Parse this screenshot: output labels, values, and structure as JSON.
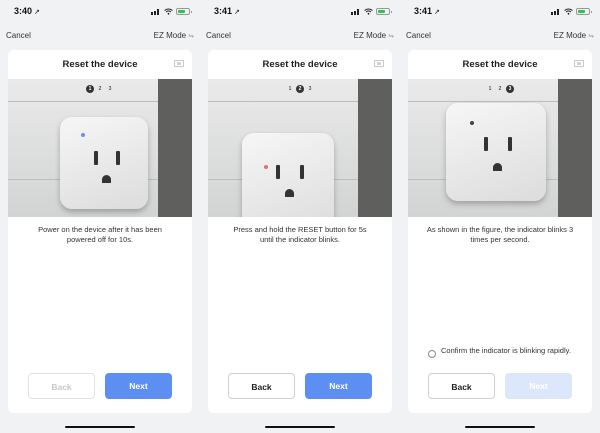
{
  "panels": [
    {
      "status_time": "3:40",
      "status_arrow": "↗",
      "nav": {
        "cancel": "Cancel",
        "mode": "EZ Mode",
        "mode_icon": "swap-icon"
      },
      "title": "Reset the device",
      "steps": [
        "1",
        "2",
        "3"
      ],
      "active_step": 1,
      "description": "Power on the device after it has been powered off for 10s.",
      "led_color": "#6b8cff",
      "back_label": "Back",
      "back_enabled": false,
      "next_label": "Next",
      "next_enabled": true
    },
    {
      "status_time": "3:41",
      "status_arrow": "↗",
      "nav": {
        "cancel": "Cancel",
        "mode": "EZ Mode",
        "mode_icon": "swap-icon"
      },
      "title": "Reset the device",
      "steps": [
        "1",
        "2",
        "3"
      ],
      "active_step": 2,
      "description": "Press and hold the RESET button for 5s until the indicator blinks.",
      "led_color": "#e07070",
      "back_label": "Back",
      "back_enabled": true,
      "next_label": "Next",
      "next_enabled": true
    },
    {
      "status_time": "3:41",
      "status_arrow": "↗",
      "nav": {
        "cancel": "Cancel",
        "mode": "EZ Mode",
        "mode_icon": "swap-icon"
      },
      "title": "Reset the device",
      "steps": [
        "1",
        "2",
        "3"
      ],
      "active_step": 3,
      "description": "As shown in the figure, the indicator blinks 3 times per second.",
      "led_color": "#444444",
      "confirm_label": "Confirm the indicator is blinking rapidly.",
      "back_label": "Back",
      "back_enabled": true,
      "next_label": "Next",
      "next_enabled": false
    }
  ],
  "colors": {
    "accent": "#5d8ff2",
    "battery": "#31c24d"
  }
}
